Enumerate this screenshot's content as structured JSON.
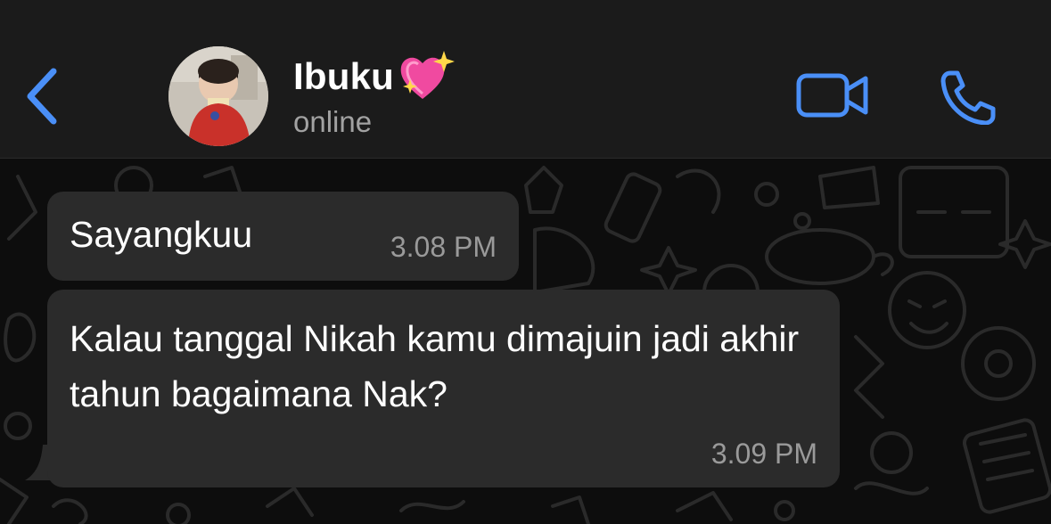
{
  "header": {
    "contact_name": "Ibuku",
    "status": "online",
    "back_icon": "chevron-left-icon",
    "video_icon": "video-camera-icon",
    "call_icon": "phone-icon",
    "accent_color": "#4a8ff7",
    "emoji": "sparkling-heart"
  },
  "messages": [
    {
      "text": "Sayangkuu",
      "time": "3.08 PM"
    },
    {
      "text": "Kalau tanggal Nikah kamu dimajuin jadi akhir tahun bagaimana Nak?",
      "time": "3.09 PM"
    }
  ]
}
